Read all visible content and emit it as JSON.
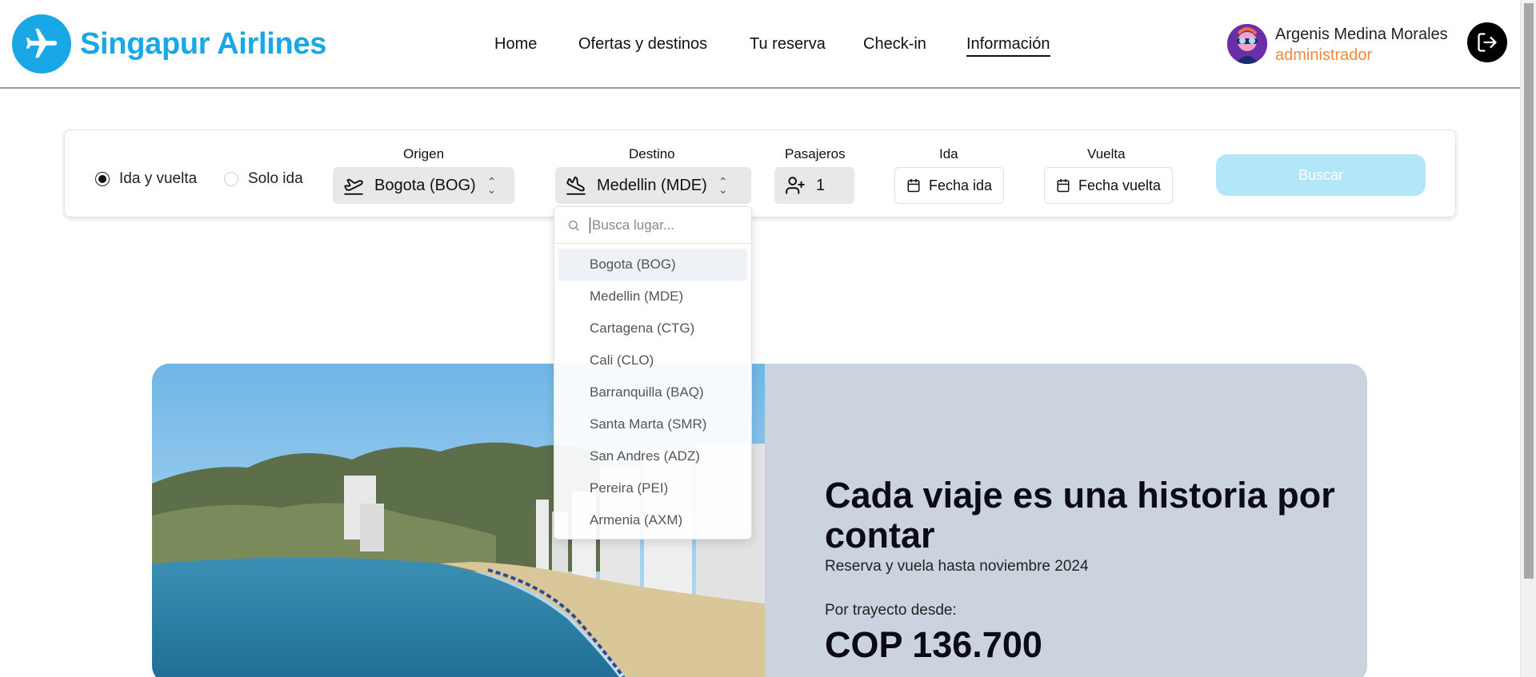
{
  "brand": {
    "name": "Singapur Airlines",
    "color": "#1aa7e6"
  },
  "nav": [
    {
      "label": "Home"
    },
    {
      "label": "Ofertas y destinos"
    },
    {
      "label": "Tu reserva"
    },
    {
      "label": "Check-in"
    },
    {
      "label": "Información",
      "active": true
    }
  ],
  "user": {
    "name": "Argenis Medina Morales",
    "role": "administrador",
    "avatar_icon": "user-avatar",
    "logout_icon": "logout-icon"
  },
  "search": {
    "trip_types": [
      {
        "label": "Ida y vuelta",
        "selected": true
      },
      {
        "label": "Solo ida",
        "selected": false
      }
    ],
    "origin": {
      "label": "Origen",
      "value": "Bogota (BOG)",
      "icon": "plane-takeoff-icon"
    },
    "destination": {
      "label": "Destino",
      "value": "Medellin (MDE)",
      "icon": "plane-landing-icon"
    },
    "passengers": {
      "label": "Pasajeros",
      "value": "1",
      "icon": "user-plus-icon"
    },
    "departure": {
      "label": "Ida",
      "value": "Fecha ida",
      "icon": "calendar-icon"
    },
    "return": {
      "label": "Vuelta",
      "value": "Fecha vuelta",
      "icon": "calendar-icon"
    },
    "submit_label": "Buscar"
  },
  "dropdown": {
    "placeholder": "Busca lugar...",
    "options": [
      "Bogota (BOG)",
      "Medellin (MDE)",
      "Cartagena (CTG)",
      "Cali (CLO)",
      "Barranquilla (BAQ)",
      "Santa Marta (SMR)",
      "San Andres (ADZ)",
      "Pereira (PEI)",
      "Armenia (AXM)"
    ],
    "highlighted": "Bogota (BOG)"
  },
  "promo": {
    "title": "Cada viaje es una historia por contar",
    "subtitle": "Reserva y vuela hasta noviembre 2024",
    "from_label": "Por trayecto desde:",
    "price": "COP 136.700",
    "background": "#cbd3de"
  }
}
